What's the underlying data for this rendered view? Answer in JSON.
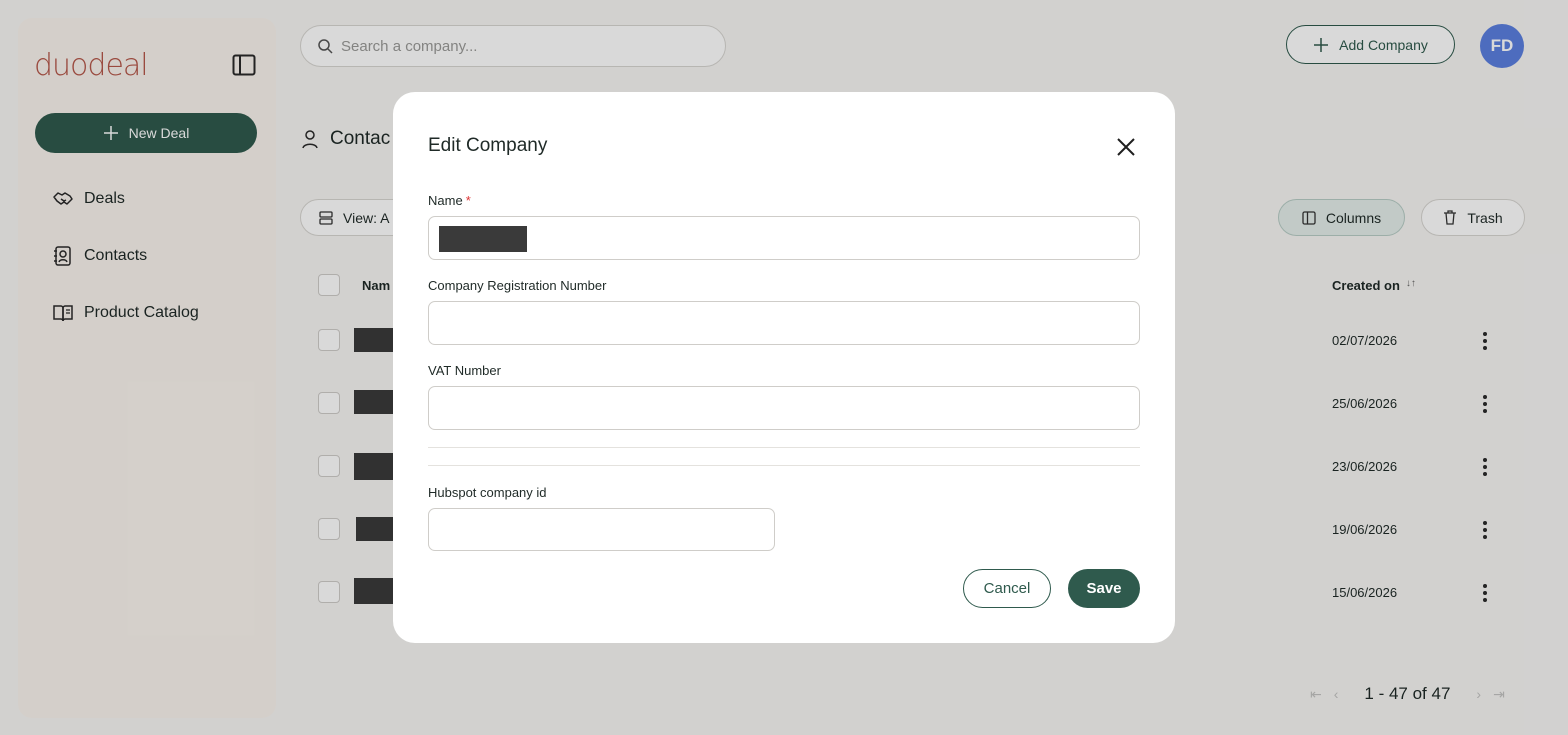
{
  "app": {
    "logo_text": "duodeal",
    "accent_color": "#2f5a4d",
    "logo_color": "#b5584a",
    "avatar_color": "#5b7fe0"
  },
  "sidebar": {
    "new_deal_label": "New Deal",
    "items": [
      {
        "label": "Deals",
        "icon": "handshake-icon"
      },
      {
        "label": "Contacts",
        "icon": "contact-card-icon"
      },
      {
        "label": "Product Catalog",
        "icon": "book-icon"
      }
    ]
  },
  "topbar": {
    "search_placeholder": "Search a company...",
    "add_company_label": "Add Company",
    "avatar_initials": "FD"
  },
  "main": {
    "page_title": "Contac",
    "view_label": "View: A",
    "columns_label": "Columns",
    "trash_label": "Trash",
    "table": {
      "header_name": "Nam",
      "header_created": "Created on",
      "sort_indicator": "↓↑",
      "rows": [
        {
          "created": "02/07/2026"
        },
        {
          "created": "25/06/2026"
        },
        {
          "created": "23/06/2026"
        },
        {
          "created": "19/06/2026"
        },
        {
          "created": "15/06/2026"
        }
      ]
    },
    "pagination": {
      "range_text": "1 - 47 of 47"
    }
  },
  "modal": {
    "title": "Edit Company",
    "fields": {
      "name_label": "Name",
      "required_mark": "*",
      "reg_number_label": "Company Registration Number",
      "reg_number_value": "",
      "vat_label": "VAT Number",
      "vat_value": "",
      "hubspot_label": "Hubspot company id",
      "hubspot_value": ""
    },
    "cancel_label": "Cancel",
    "save_label": "Save"
  }
}
